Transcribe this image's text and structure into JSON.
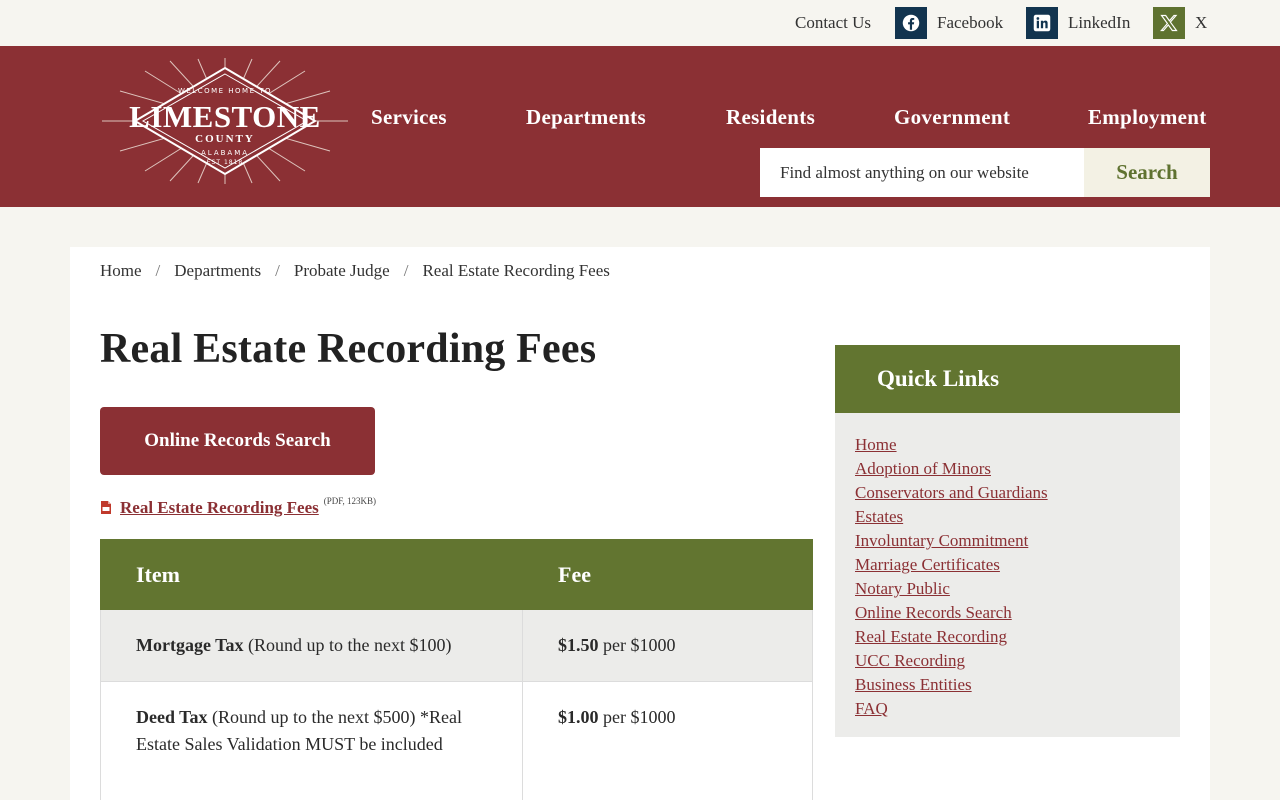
{
  "util": {
    "contact": "Contact Us",
    "facebook": "Facebook",
    "linkedin": "LinkedIn",
    "x": "X"
  },
  "logo": {
    "top": "WELCOME HOME TO",
    "name": "LIMESTONE",
    "county": "COUNTY",
    "state": "ALABAMA",
    "est": "EST 1818"
  },
  "nav": [
    "Services",
    "Departments",
    "Residents",
    "Government",
    "Employment"
  ],
  "search": {
    "placeholder": "Find almost anything on our website",
    "button": "Search"
  },
  "breadcrumb": [
    "Home",
    "Departments",
    "Probate Judge",
    "Real Estate Recording Fees"
  ],
  "page": {
    "title": "Real Estate Recording Fees",
    "records_button": "Online Records Search",
    "pdf_link": "Real Estate Recording Fees",
    "pdf_meta": "(PDF, 123KB)"
  },
  "table": {
    "headers": [
      "Item",
      "Fee"
    ],
    "rows": [
      {
        "item_bold": "Mortgage Tax",
        "item_rest": " (Round up to the next $100)",
        "fee_bold": "$1.50",
        "fee_rest": " per $1000"
      },
      {
        "item_bold": "Deed Tax",
        "item_rest": " (Round up to the next $500) *Real Estate Sales Validation MUST be included",
        "fee_bold": "$1.00",
        "fee_rest": " per $1000"
      }
    ]
  },
  "quick_links": {
    "title": "Quick Links",
    "items": [
      "Home",
      "Adoption of Minors",
      "Conservators and Guardians",
      "Estates",
      "Involuntary Commitment",
      "Marriage Certificates",
      "Notary Public",
      "Online Records Search",
      "Real Estate Recording",
      "UCC Recording",
      "Business Entities",
      "FAQ"
    ]
  },
  "colors": {
    "brand_red": "#8b3034",
    "brand_green": "#627530",
    "facebook": "#12344f",
    "linkedin": "#12344f",
    "x": "#5f7230"
  }
}
